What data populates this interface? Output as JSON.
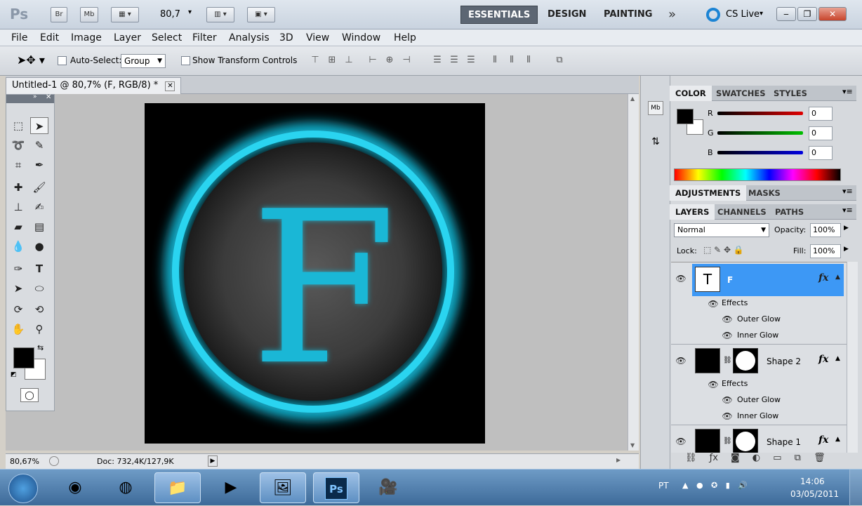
{
  "app": {
    "logo": "Ps",
    "bridge": "Br",
    "mini_bridge": "Mb",
    "zoom": "80,7"
  },
  "workspaces": [
    "ESSENTIALS",
    "DESIGN",
    "PAINTING"
  ],
  "cs_live": "CS Live",
  "menu": [
    "File",
    "Edit",
    "Image",
    "Layer",
    "Select",
    "Filter",
    "Analysis",
    "3D",
    "View",
    "Window",
    "Help"
  ],
  "options": {
    "auto_select": "Auto-Select:",
    "auto_select_value": "Group",
    "transform": "Show Transform Controls"
  },
  "document": {
    "tab": "Untitled-1 @ 80,7% (F, RGB/8) *",
    "letter": "F"
  },
  "status": {
    "zoom": "80,67%",
    "doc": "Doc: 732,4K/127,9K"
  },
  "color_panel": {
    "tabs": [
      "COLOR",
      "SWATCHES",
      "STYLES"
    ],
    "channels": [
      {
        "label": "R",
        "value": "0",
        "color": "#e00000"
      },
      {
        "label": "G",
        "value": "0",
        "color": "#00c000"
      },
      {
        "label": "B",
        "value": "0",
        "color": "#0000e0"
      }
    ]
  },
  "adjust_panel": {
    "tabs": [
      "ADJUSTMENTS",
      "MASKS"
    ]
  },
  "layers_panel": {
    "tabs": [
      "LAYERS",
      "CHANNELS",
      "PATHS"
    ],
    "blend_mode": "Normal",
    "opacity_label": "Opacity:",
    "opacity": "100%",
    "lock_label": "Lock:",
    "fill_label": "Fill:",
    "fill": "100%",
    "layers": [
      {
        "name": "F",
        "thumb_text": "T",
        "effects_label": "Effects",
        "effects": [
          "Outer Glow",
          "Inner Glow"
        ]
      },
      {
        "name": "Shape 2",
        "effects_label": "Effects",
        "effects": [
          "Outer Glow",
          "Inner Glow"
        ]
      },
      {
        "name": "Shape 1"
      }
    ],
    "fx": "fx"
  },
  "taskbar": {
    "lang": "PT",
    "time": "14:06",
    "date": "03/05/2011"
  },
  "colors": {
    "glow": "#14c6e6",
    "accent": "#3d98f5"
  }
}
